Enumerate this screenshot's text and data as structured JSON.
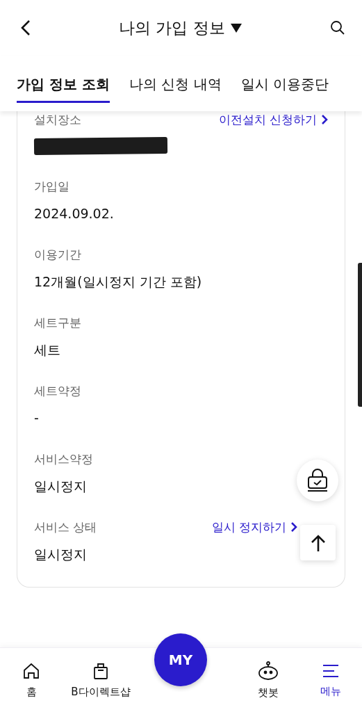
{
  "header": {
    "title": "나의 가입 정보"
  },
  "tabs": [
    {
      "label": "가입 정보 조회",
      "selected": true
    },
    {
      "label": "나의 신청 내역",
      "selected": false
    },
    {
      "label": "일시 이용중단",
      "selected": false
    }
  ],
  "fields": [
    {
      "label": "설치장소",
      "kind": "redacted",
      "link": "이전설치 신청하기"
    },
    {
      "label": "가입일",
      "kind": "text",
      "value": "2024.09.02."
    },
    {
      "label": "이용기간",
      "kind": "text",
      "value": "12개월(일시정지 기간 포함)"
    },
    {
      "label": "세트구분",
      "kind": "text",
      "value": "세트"
    },
    {
      "label": "세트약정",
      "kind": "text",
      "value": "-"
    },
    {
      "label": "서비스약정",
      "kind": "text",
      "value": "일시정지"
    },
    {
      "label": "서비스 상태",
      "kind": "text",
      "value": "일시정지",
      "link": "일시 정지하기"
    }
  ],
  "bottom_nav": {
    "center": "MY",
    "items": [
      {
        "label": "홈",
        "selected": false
      },
      {
        "label": "B다이렉트샵",
        "selected": false
      },
      {
        "label": "챗봇",
        "selected": false
      },
      {
        "label": "메뉴",
        "selected": true
      }
    ]
  }
}
